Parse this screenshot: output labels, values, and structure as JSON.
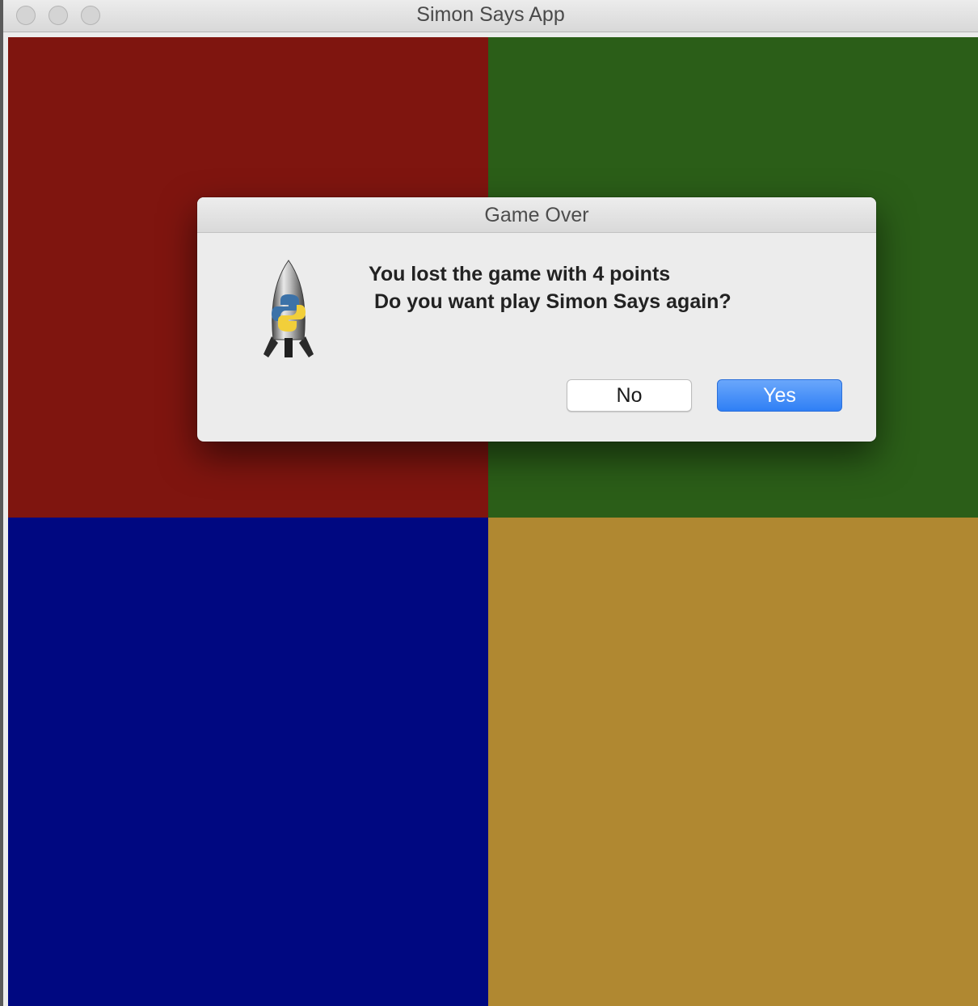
{
  "window": {
    "title": "Simon Says App"
  },
  "board": {
    "colors": {
      "red": "#7f150f",
      "green": "#2b5e18",
      "blue": "#000881",
      "yellow": "#b08831"
    }
  },
  "dialog": {
    "title": "Game Over",
    "message": "You lost the game with 4 points\n Do you want play Simon Says again?",
    "no_label": "No",
    "yes_label": "Yes",
    "icon": "python-launcher-rocket-icon"
  }
}
